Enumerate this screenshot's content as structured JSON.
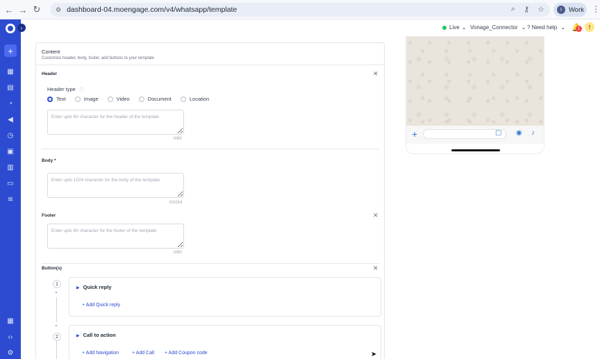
{
  "browser": {
    "url": "dashboard-04.moengage.com/v4/whatsapp/template",
    "profile_initial": "I",
    "profile_label": "Work"
  },
  "topbar": {
    "env_label": "Live",
    "connector_label": "Vonage_Connector",
    "help_label": "Need help",
    "notification_count": "1",
    "warning_glyph": "!"
  },
  "content": {
    "title": "Content",
    "subtitle": "Customize header, body, footer, add buttons to your template",
    "header": {
      "label": "Header",
      "type_label": "Header type",
      "options": [
        "Text",
        "Image",
        "Video",
        "Document",
        "Location"
      ],
      "selected": "Text",
      "placeholder": "Enter upto 60 character for the header of the template",
      "counter": "0/60"
    },
    "body": {
      "label": "Body *",
      "placeholder": "Enter upto 1024 character for the body of the template",
      "counter": "0/1024"
    },
    "footer": {
      "label": "Footer",
      "placeholder": "Enter upto 60 character for the footer of the template",
      "counter": "0/60"
    },
    "buttons": {
      "label": "Button(s)",
      "groups": [
        {
          "step": "1",
          "title": "Quick reply",
          "actions": [
            "Add Quick reply"
          ]
        },
        {
          "step": "2",
          "title": "Call to action",
          "actions": [
            "Add Navigation",
            "Add Call",
            "Add Coupon code"
          ]
        }
      ]
    }
  },
  "icons": {
    "back": "back-arrow-icon",
    "forward": "forward-arrow-icon",
    "reload": "reload-icon",
    "site_info": "site-info-icon",
    "zoom": "zoom-icon",
    "key": "key-icon",
    "star": "star-icon",
    "close": "close-icon"
  },
  "colors": {
    "brand": "#2c4bd1",
    "live": "#22c55e",
    "badge": "#ef4444",
    "link": "#2c4bd1"
  }
}
